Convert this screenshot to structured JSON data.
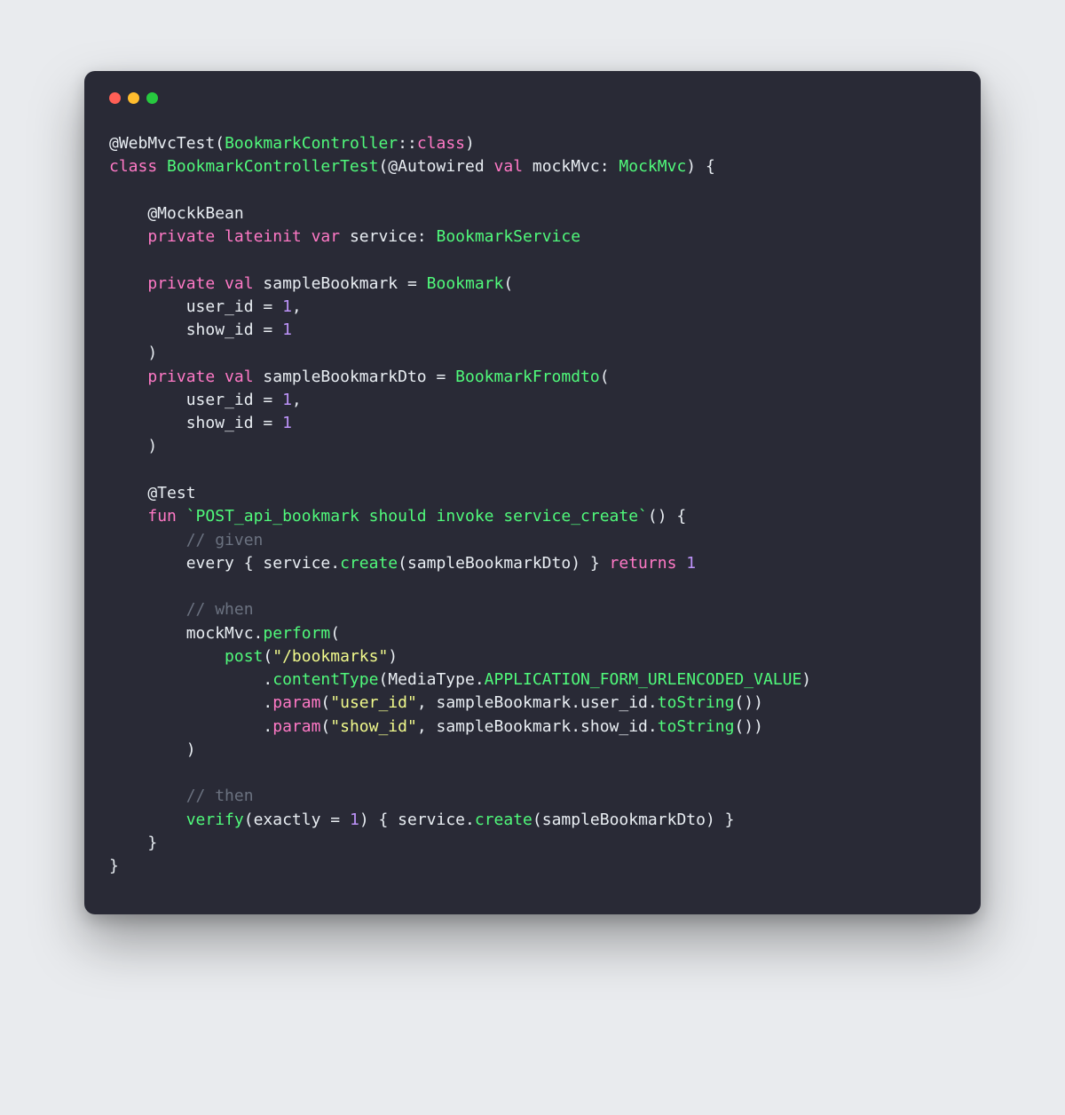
{
  "window": {
    "traffic": {
      "red": "#ff5f56",
      "yellow": "#ffbd2e",
      "green": "#27c93f"
    }
  },
  "code": {
    "tokens": [
      {
        "t": "@WebMvcTest",
        "c": "c-ann"
      },
      {
        "t": "(",
        "c": "c-punc"
      },
      {
        "t": "BookmarkController",
        "c": "c-fn"
      },
      {
        "t": "::",
        "c": "c-punc"
      },
      {
        "t": "class",
        "c": "c-kw"
      },
      {
        "t": ")",
        "c": "c-punc"
      },
      {
        "t": "\n"
      },
      {
        "t": "class ",
        "c": "c-kw"
      },
      {
        "t": "BookmarkControllerTest",
        "c": "c-fn"
      },
      {
        "t": "(",
        "c": "c-punc"
      },
      {
        "t": "@Autowired ",
        "c": "c-ann"
      },
      {
        "t": "val ",
        "c": "c-kw"
      },
      {
        "t": "mockMvc",
        "c": "c-id"
      },
      {
        "t": ": ",
        "c": "c-punc"
      },
      {
        "t": "MockMvc",
        "c": "c-fn"
      },
      {
        "t": ") {",
        "c": "c-punc"
      },
      {
        "t": "\n"
      },
      {
        "t": "\n"
      },
      {
        "t": "    @MockkBean",
        "c": "c-ann"
      },
      {
        "t": "\n"
      },
      {
        "t": "    ",
        "c": ""
      },
      {
        "t": "private lateinit var ",
        "c": "c-kw"
      },
      {
        "t": "service",
        "c": "c-id"
      },
      {
        "t": ": ",
        "c": "c-punc"
      },
      {
        "t": "BookmarkService",
        "c": "c-fn"
      },
      {
        "t": "\n"
      },
      {
        "t": "\n"
      },
      {
        "t": "    ",
        "c": ""
      },
      {
        "t": "private val ",
        "c": "c-kw"
      },
      {
        "t": "sampleBookmark ",
        "c": "c-id"
      },
      {
        "t": "= ",
        "c": "c-punc"
      },
      {
        "t": "Bookmark",
        "c": "c-fn"
      },
      {
        "t": "(",
        "c": "c-punc"
      },
      {
        "t": "\n"
      },
      {
        "t": "        user_id ",
        "c": "c-id"
      },
      {
        "t": "= ",
        "c": "c-punc"
      },
      {
        "t": "1",
        "c": "c-num"
      },
      {
        "t": ",",
        "c": "c-punc"
      },
      {
        "t": "\n"
      },
      {
        "t": "        show_id ",
        "c": "c-id"
      },
      {
        "t": "= ",
        "c": "c-punc"
      },
      {
        "t": "1",
        "c": "c-num"
      },
      {
        "t": "\n"
      },
      {
        "t": "    )",
        "c": "c-punc"
      },
      {
        "t": "\n"
      },
      {
        "t": "    ",
        "c": ""
      },
      {
        "t": "private val ",
        "c": "c-kw"
      },
      {
        "t": "sampleBookmarkDto ",
        "c": "c-id"
      },
      {
        "t": "= ",
        "c": "c-punc"
      },
      {
        "t": "BookmarkFromdto",
        "c": "c-fn"
      },
      {
        "t": "(",
        "c": "c-punc"
      },
      {
        "t": "\n"
      },
      {
        "t": "        user_id ",
        "c": "c-id"
      },
      {
        "t": "= ",
        "c": "c-punc"
      },
      {
        "t": "1",
        "c": "c-num"
      },
      {
        "t": ",",
        "c": "c-punc"
      },
      {
        "t": "\n"
      },
      {
        "t": "        show_id ",
        "c": "c-id"
      },
      {
        "t": "= ",
        "c": "c-punc"
      },
      {
        "t": "1",
        "c": "c-num"
      },
      {
        "t": "\n"
      },
      {
        "t": "    )",
        "c": "c-punc"
      },
      {
        "t": "\n"
      },
      {
        "t": "\n"
      },
      {
        "t": "    @Test",
        "c": "c-ann"
      },
      {
        "t": "\n"
      },
      {
        "t": "    ",
        "c": ""
      },
      {
        "t": "fun ",
        "c": "c-kw"
      },
      {
        "t": "`POST_api_bookmark should invoke service_create`",
        "c": "c-fn"
      },
      {
        "t": "() {",
        "c": "c-punc"
      },
      {
        "t": "\n"
      },
      {
        "t": "        ",
        "c": ""
      },
      {
        "t": "// given",
        "c": "c-cmt"
      },
      {
        "t": "\n"
      },
      {
        "t": "        every { service.",
        "c": "c-id"
      },
      {
        "t": "create",
        "c": "c-fn"
      },
      {
        "t": "(sampleBookmarkDto) } ",
        "c": "c-id"
      },
      {
        "t": "returns ",
        "c": "c-kw"
      },
      {
        "t": "1",
        "c": "c-num"
      },
      {
        "t": "\n"
      },
      {
        "t": "\n"
      },
      {
        "t": "        ",
        "c": ""
      },
      {
        "t": "// when",
        "c": "c-cmt"
      },
      {
        "t": "\n"
      },
      {
        "t": "        mockMvc.",
        "c": "c-id"
      },
      {
        "t": "perform",
        "c": "c-fn"
      },
      {
        "t": "(",
        "c": "c-punc"
      },
      {
        "t": "\n"
      },
      {
        "t": "            ",
        "c": ""
      },
      {
        "t": "post",
        "c": "c-fn"
      },
      {
        "t": "(",
        "c": "c-punc"
      },
      {
        "t": "\"/bookmarks\"",
        "c": "c-str"
      },
      {
        "t": ")",
        "c": "c-punc"
      },
      {
        "t": "\n"
      },
      {
        "t": "                .",
        "c": "c-punc"
      },
      {
        "t": "contentType",
        "c": "c-fn"
      },
      {
        "t": "(MediaType.",
        "c": "c-id"
      },
      {
        "t": "APPLICATION_FORM_URLENCODED_VALUE",
        "c": "c-fn"
      },
      {
        "t": ")",
        "c": "c-punc"
      },
      {
        "t": "\n"
      },
      {
        "t": "                .",
        "c": "c-punc"
      },
      {
        "t": "param",
        "c": "c-kw"
      },
      {
        "t": "(",
        "c": "c-punc"
      },
      {
        "t": "\"user_id\"",
        "c": "c-str"
      },
      {
        "t": ", sampleBookmark.user_id.",
        "c": "c-id"
      },
      {
        "t": "toString",
        "c": "c-fn"
      },
      {
        "t": "())",
        "c": "c-punc"
      },
      {
        "t": "\n"
      },
      {
        "t": "                .",
        "c": "c-punc"
      },
      {
        "t": "param",
        "c": "c-kw"
      },
      {
        "t": "(",
        "c": "c-punc"
      },
      {
        "t": "\"show_id\"",
        "c": "c-str"
      },
      {
        "t": ", sampleBookmark.show_id.",
        "c": "c-id"
      },
      {
        "t": "toString",
        "c": "c-fn"
      },
      {
        "t": "())",
        "c": "c-punc"
      },
      {
        "t": "\n"
      },
      {
        "t": "        )",
        "c": "c-punc"
      },
      {
        "t": "\n"
      },
      {
        "t": "\n"
      },
      {
        "t": "        ",
        "c": ""
      },
      {
        "t": "// then",
        "c": "c-cmt"
      },
      {
        "t": "\n"
      },
      {
        "t": "        ",
        "c": ""
      },
      {
        "t": "verify",
        "c": "c-fn"
      },
      {
        "t": "(exactly ",
        "c": "c-id"
      },
      {
        "t": "= ",
        "c": "c-punc"
      },
      {
        "t": "1",
        "c": "c-num"
      },
      {
        "t": ") { service.",
        "c": "c-id"
      },
      {
        "t": "create",
        "c": "c-fn"
      },
      {
        "t": "(sampleBookmarkDto) }",
        "c": "c-id"
      },
      {
        "t": "\n"
      },
      {
        "t": "    }",
        "c": "c-punc"
      },
      {
        "t": "\n"
      },
      {
        "t": "}",
        "c": "c-punc"
      }
    ]
  }
}
